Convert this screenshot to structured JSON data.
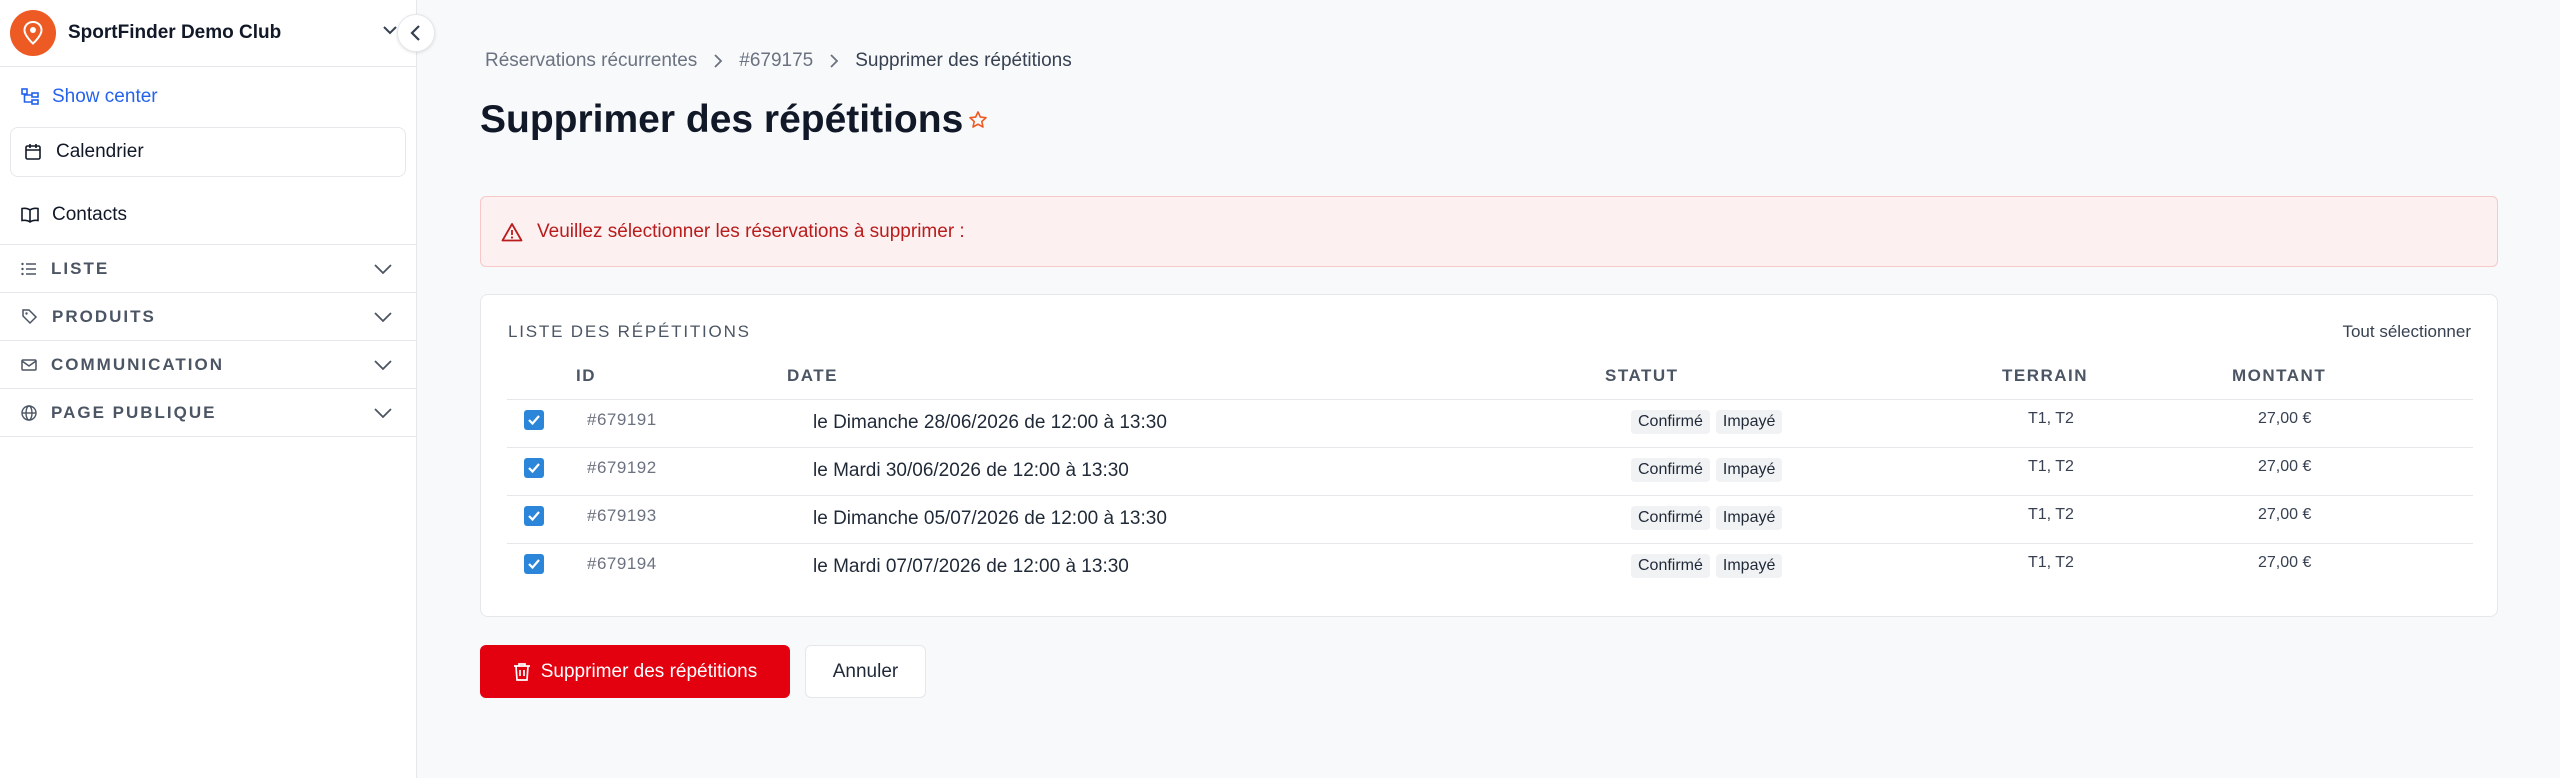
{
  "sidebar": {
    "club_name": "SportFinder Demo Club",
    "show_center": "Show center",
    "calendar": "Calendrier",
    "contacts": "Contacts",
    "sections": [
      "LISTE",
      "PRODUITS",
      "COMMUNICATION",
      "PAGE PUBLIQUE"
    ]
  },
  "breadcrumb": {
    "item1": "Réservations récurrentes",
    "item2": "#679175",
    "current": "Supprimer des répétitions"
  },
  "page": {
    "title": "Supprimer des répétitions"
  },
  "alert": {
    "message": "Veuillez sélectionner les réservations à supprimer :"
  },
  "list": {
    "title": "LISTE DES RÉPÉTITIONS",
    "select_all": "Tout sélectionner",
    "columns": {
      "id": "ID",
      "date": "DATE",
      "statut": "STATUT",
      "terrain": "TERRAIN",
      "montant": "MONTANT"
    },
    "rows": [
      {
        "id": "#679191",
        "date": "le Dimanche 28/06/2026 de 12:00 à 13:30",
        "status1": "Confirmé",
        "status2": "Impayé",
        "terrain": "T1, T2",
        "montant": "27,00 €",
        "checked": true
      },
      {
        "id": "#679192",
        "date": "le Mardi 30/06/2026 de 12:00 à 13:30",
        "status1": "Confirmé",
        "status2": "Impayé",
        "terrain": "T1, T2",
        "montant": "27,00 €",
        "checked": true
      },
      {
        "id": "#679193",
        "date": "le Dimanche 05/07/2026 de 12:00 à 13:30",
        "status1": "Confirmé",
        "status2": "Impayé",
        "terrain": "T1, T2",
        "montant": "27,00 €",
        "checked": true
      },
      {
        "id": "#679194",
        "date": "le Mardi 07/07/2026 de 12:00 à 13:30",
        "status1": "Confirmé",
        "status2": "Impayé",
        "terrain": "T1, T2",
        "montant": "27,00 €",
        "checked": true
      }
    ]
  },
  "actions": {
    "delete": "Supprimer des répétitions",
    "cancel": "Annuler"
  },
  "colors": {
    "brand_orange": "#ee5a24",
    "danger_red": "#e3000f",
    "checkbox_blue": "#2b86d9",
    "link_blue": "#2563eb"
  }
}
